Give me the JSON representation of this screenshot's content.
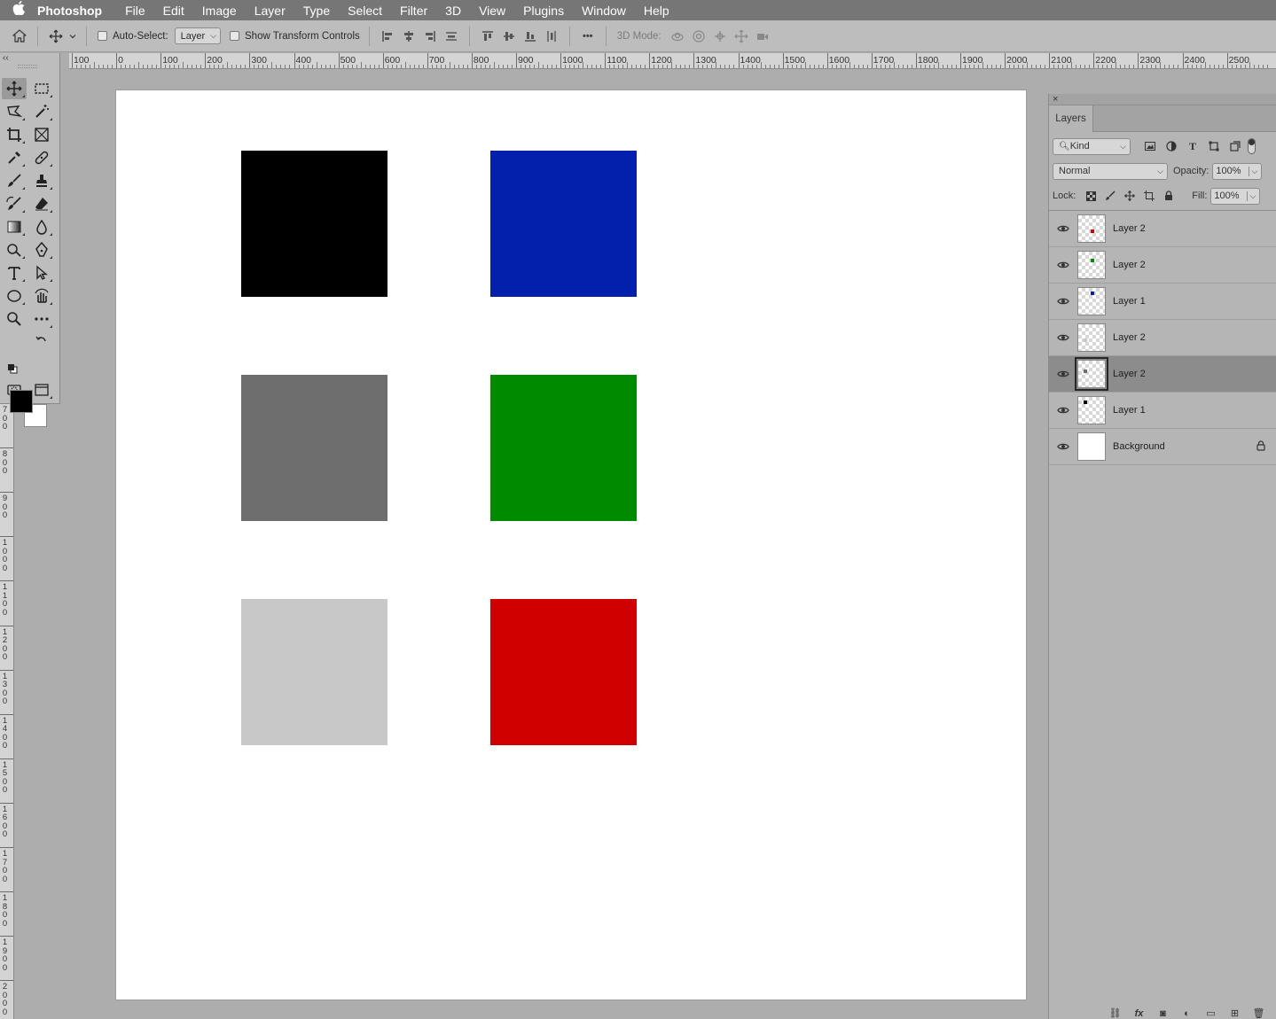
{
  "menubar": {
    "apple": "",
    "app_name": "Photoshop",
    "items": [
      "File",
      "Edit",
      "Image",
      "Layer",
      "Type",
      "Select",
      "Filter",
      "3D",
      "View",
      "Plugins",
      "Window",
      "Help"
    ]
  },
  "options_bar": {
    "auto_select_label": "Auto-Select:",
    "auto_select_value": "Layer",
    "show_transform_label": "Show Transform Controls",
    "mode_3d_label": "3D Mode:",
    "more_label": "•••"
  },
  "ruler": {
    "top_labels": [
      "100",
      "0",
      "100",
      "200",
      "300",
      "400",
      "500",
      "600",
      "700",
      "800",
      "900",
      "1000",
      "1100",
      "1200",
      "1300",
      "1400",
      "1500",
      "1600",
      "1700",
      "1800",
      "1900",
      "2000",
      "2100",
      "2200",
      "2300",
      "2400",
      "2500"
    ],
    "left_labels": [
      "700",
      "800",
      "900",
      "1000",
      "1100",
      "1200",
      "1300",
      "1400",
      "1500",
      "1600",
      "1700",
      "1800",
      "1900",
      "2000"
    ]
  },
  "toolbar": {
    "collapse_glyph": "‹‹",
    "foreground_color": "#000000",
    "background_color": "#ffffff"
  },
  "canvas": {
    "background": "#ffffff",
    "squares": [
      {
        "color": "#000000"
      },
      {
        "color": "#0220ac"
      },
      {
        "color": "#6e6e6e"
      },
      {
        "color": "#008a00"
      },
      {
        "color": "#c8c8c8"
      },
      {
        "color": "#d10000"
      }
    ]
  },
  "layers_panel": {
    "tab_label": "Layers",
    "filter_kind": "Kind",
    "blend_mode": "Normal",
    "opacity_label": "Opacity:",
    "opacity_value": "100%",
    "lock_label": "Lock:",
    "fill_label": "Fill:",
    "fill_value": "100%",
    "layers": [
      {
        "name": "Layer 2",
        "thumb_dot": "#d10000",
        "selected": false
      },
      {
        "name": "Layer 2",
        "thumb_dot": "#008a00",
        "selected": false
      },
      {
        "name": "Layer 1",
        "thumb_dot": "#0220ac",
        "selected": false
      },
      {
        "name": "Layer 2",
        "thumb_dot": "#c8c8c8",
        "selected": false
      },
      {
        "name": "Layer 2",
        "thumb_dot": "#6e6e6e",
        "selected": true
      },
      {
        "name": "Layer 1",
        "thumb_dot": "#000000",
        "selected": false
      },
      {
        "name": "Background",
        "thumb_dot": null,
        "selected": false
      }
    ]
  }
}
